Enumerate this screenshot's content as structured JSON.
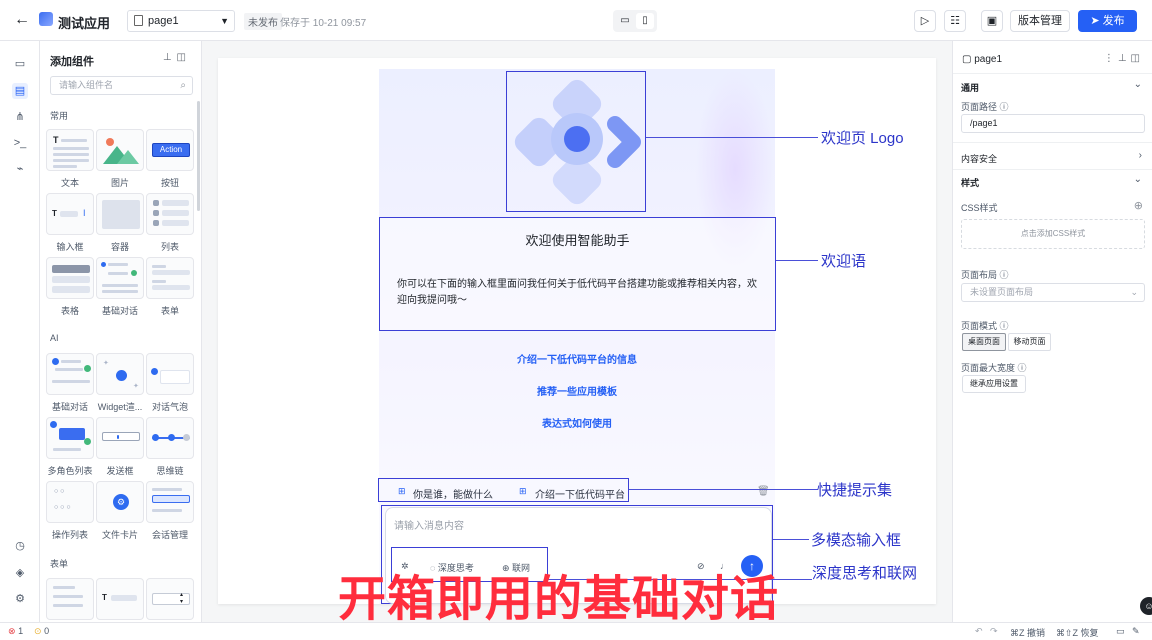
{
  "topbar": {
    "app_title": "测试应用",
    "page_select": "page1",
    "status": "未发布",
    "saved_at": "保存于 10-21 09:57",
    "version_label": "版本管理",
    "publish_label": "发布"
  },
  "left_panel": {
    "title": "添加组件",
    "search_placeholder": "请输入组件名",
    "groups": [
      {
        "label": "常用",
        "items": [
          "文本",
          "图片",
          "按钮",
          "输入框",
          "容器",
          "列表",
          "表格",
          "基础对话",
          "表单"
        ]
      },
      {
        "label": "AI",
        "items": [
          "基础对话",
          "Widget渲...",
          "对话气泡",
          "多角色列表",
          "发送框",
          "思维链",
          "操作列表",
          "文件卡片",
          "会话管理"
        ]
      },
      {
        "label": "表单",
        "items": []
      }
    ],
    "action_thumb": "Action"
  },
  "canvas": {
    "welcome_title": "欢迎使用智能助手",
    "welcome_text": "你可以在下面的输入框里面问我任何关于低代码平台搭建功能或推荐相关内容，欢迎向我提问哦～",
    "suggestions": [
      "介绍一下低代码平台的信息",
      "推荐一些应用模板",
      "表达式如何使用"
    ],
    "quick_prompts": [
      "你是谁，能做什么",
      "介绍一下低代码平台"
    ],
    "input_placeholder": "请输入消息内容",
    "deep_controls": [
      "深度思考",
      "联网"
    ]
  },
  "annotations": {
    "logo": "欢迎页 Logo",
    "welcome": "欢迎语",
    "quick": "快捷提示集",
    "input": "多模态输入框",
    "deep": "深度思考和联网",
    "overlay": "开箱即用的基础对话"
  },
  "right_panel": {
    "page_name": "page1",
    "section_general": "通用",
    "page_path_label": "页面路径",
    "page_path_value": "/page1",
    "content_safety": "内容安全",
    "section_style": "样式",
    "css_label": "CSS样式",
    "css_add": "点击添加CSS样式",
    "layout_label": "页面布局",
    "layout_placeholder": "未设置页面布局",
    "mode_label": "页面模式",
    "mode_desktop": "桌面页面",
    "mode_mobile": "移动页面",
    "max_width_label": "页面最大宽度",
    "max_width_btn": "继承应用设置"
  },
  "statusbar": {
    "errors": "1",
    "warnings": "0",
    "undo": "撤销",
    "redo": "恢复"
  }
}
